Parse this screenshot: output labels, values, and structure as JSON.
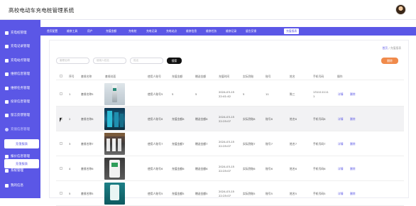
{
  "header": {
    "title": "高校电动车充电桩管理系统"
  },
  "sidebar": {
    "items": [
      "充电桩管理",
      "充电记录管理",
      "充电站点管理",
      "维修信息管理",
      "维修任务管理",
      "投诉信息管理",
      "留言反馈管理",
      "充值信息管理",
      "报价信息管理",
      "系统管理",
      "我的信息"
    ],
    "sub_item": "充值报表"
  },
  "tabs": [
    "首页配置",
    "维修工具",
    "用户",
    "充值金额",
    "充电桩",
    "充电记录",
    "充电站点",
    "维修信息",
    "维修任务",
    "维修记录",
    "留言反馈",
    "充值报表"
  ],
  "breadcrumb": {
    "home": "首页",
    "sep": "/",
    "current": "充值报表"
  },
  "search": {
    "placeholder1": "套餐名称",
    "placeholder2": "使用人姓名",
    "placeholder3": "姓名",
    "button": "搜索"
  },
  "toolbar": {
    "delete": "删除"
  },
  "table": {
    "headers": [
      "序号",
      "套餐名称",
      "套餐封面",
      "使用人账号",
      "充值金额",
      "赠送金额",
      "充值时间",
      "实际到账",
      "账号",
      "姓名",
      "手机号码",
      "操作"
    ],
    "rows": [
      {
        "index": "1",
        "name": "套餐名称5",
        "user": "使用人账号5",
        "amount": "5",
        "bonus": "5",
        "date": "2024-03-15",
        "time": "22:41:42",
        "actual": "5",
        "acc": "11",
        "uname": "陈三",
        "phone1": "131111111",
        "phone2": "1"
      },
      {
        "index": "2",
        "name": "套餐名称8",
        "user": "使用人账号8",
        "amount": "充值金额8",
        "bonus": "赠送金额8",
        "date": "2024-03-15",
        "time": "22:25:07",
        "actual": "实际到账8",
        "acc": "账号8",
        "uname": "姓名8",
        "phone1": "手机号码8",
        "phone2": ""
      },
      {
        "index": "3",
        "name": "套餐名称7",
        "user": "使用人账号7",
        "amount": "充值金额7",
        "bonus": "赠送金额7",
        "date": "2024-03-15",
        "time": "22:25:07",
        "actual": "实际到账7",
        "acc": "账号7",
        "uname": "姓名7",
        "phone1": "手机号码7",
        "phone2": ""
      },
      {
        "index": "4",
        "name": "套餐名称6",
        "user": "使用人账号6",
        "amount": "充值金额6",
        "bonus": "赠送金额6",
        "date": "2024-03-15",
        "time": "22:25:07",
        "actual": "实际到账6",
        "acc": "账号6",
        "uname": "姓名6",
        "phone1": "手机号码6",
        "phone2": ""
      },
      {
        "index": "5",
        "name": "套餐名称5",
        "user": "使用人账号5",
        "amount": "充值金额5",
        "bonus": "赠送金额5",
        "date": "2024-03-15",
        "time": "22:25:07",
        "actual": "实际到账5",
        "acc": "账号5",
        "uname": "姓名5",
        "phone1": "手机号码5",
        "phone2": ""
      }
    ],
    "actions": {
      "detail": "详情",
      "delete": "删除"
    }
  },
  "colors": {
    "accent": "#5b57e6",
    "danger": "#f08a4b"
  }
}
